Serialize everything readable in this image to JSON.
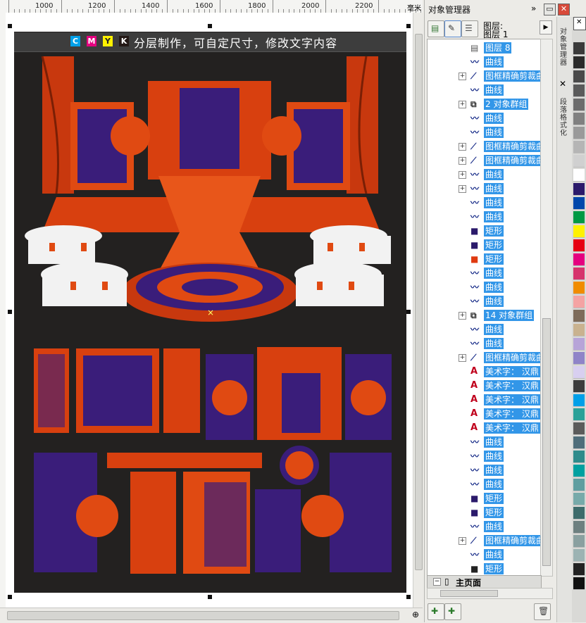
{
  "ruler": {
    "labels": [
      "1000",
      "1200",
      "1400",
      "1600",
      "1800",
      "2000",
      "2200"
    ],
    "unit": "毫米"
  },
  "canvas": {
    "banner_text": "分层制作，可自定尺寸，修改文字内容",
    "cmyk_letters": [
      "C",
      "M",
      "Y",
      "K"
    ],
    "cmyk_colors": [
      "#00a0e9",
      "#e4007f",
      "#fff100",
      "#231815"
    ],
    "artboard_color": "#232120"
  },
  "object_manager": {
    "title": "对象管理器",
    "layer_label": "图层:",
    "layer_value": "图层 1",
    "footer_label": "主页面",
    "rows": [
      {
        "label": "图层 8",
        "icon": "layer-icon",
        "expander": false,
        "selected": true
      },
      {
        "label": "曲线",
        "icon": "curve-icon",
        "expander": false,
        "selected": true
      },
      {
        "label": "图框精确剪裁曲",
        "icon": "powerclip-icon",
        "expander": true,
        "selected": true
      },
      {
        "label": "曲线",
        "icon": "curve-icon",
        "expander": false,
        "selected": true
      },
      {
        "label": "2 对象群组",
        "icon": "group-icon",
        "expander": true,
        "selected": true
      },
      {
        "label": "曲线",
        "icon": "curve-icon",
        "expander": false,
        "selected": true
      },
      {
        "label": "曲线",
        "icon": "curve-icon",
        "expander": false,
        "selected": true
      },
      {
        "label": "图框精确剪裁曲",
        "icon": "powerclip-icon",
        "expander": true,
        "selected": true
      },
      {
        "label": "图框精确剪裁曲",
        "icon": "powerclip-icon",
        "expander": true,
        "selected": true
      },
      {
        "label": "曲线",
        "icon": "curve-icon",
        "expander": true,
        "selected": true
      },
      {
        "label": "曲线",
        "icon": "curve-icon",
        "expander": true,
        "selected": true
      },
      {
        "label": "曲线",
        "icon": "curve-icon",
        "expander": false,
        "selected": true
      },
      {
        "label": "曲线",
        "icon": "curve-icon",
        "expander": false,
        "selected": true
      },
      {
        "label": "矩形",
        "icon": "rect-purple-icon",
        "expander": false,
        "selected": true
      },
      {
        "label": "矩形",
        "icon": "rect-purple-icon",
        "expander": false,
        "selected": true
      },
      {
        "label": "矩形",
        "icon": "rect-red-icon",
        "expander": false,
        "selected": true
      },
      {
        "label": "曲线",
        "icon": "curve-icon",
        "expander": false,
        "selected": true
      },
      {
        "label": "曲线",
        "icon": "curve-icon",
        "expander": false,
        "selected": true
      },
      {
        "label": "曲线",
        "icon": "curve-icon",
        "expander": false,
        "selected": true
      },
      {
        "label": "14 对象群组",
        "icon": "group-icon",
        "expander": true,
        "selected": true
      },
      {
        "label": "曲线",
        "icon": "curve-icon",
        "expander": false,
        "selected": true
      },
      {
        "label": "曲线",
        "icon": "curve-icon",
        "expander": false,
        "selected": true
      },
      {
        "label": "图框精确剪裁曲",
        "icon": "powerclip-icon",
        "expander": true,
        "selected": true
      },
      {
        "label": "美术字： 汉鼎",
        "icon": "artistic-text-icon",
        "expander": false,
        "selected": true
      },
      {
        "label": "美术字： 汉鼎",
        "icon": "artistic-text-icon",
        "expander": false,
        "selected": true
      },
      {
        "label": "美术字： 汉鼎",
        "icon": "artistic-text-icon",
        "expander": false,
        "selected": true
      },
      {
        "label": "美术字： 汉鼎",
        "icon": "artistic-text-icon",
        "expander": false,
        "selected": true
      },
      {
        "label": "美术字： 汉鼎",
        "icon": "artistic-text-icon",
        "expander": false,
        "selected": true
      },
      {
        "label": "曲线",
        "icon": "curve-icon",
        "expander": false,
        "selected": true
      },
      {
        "label": "曲线",
        "icon": "curve-icon",
        "expander": false,
        "selected": true
      },
      {
        "label": "曲线",
        "icon": "curve-icon",
        "expander": false,
        "selected": true
      },
      {
        "label": "曲线",
        "icon": "curve-icon",
        "expander": false,
        "selected": true
      },
      {
        "label": "矩形",
        "icon": "rect-purple-icon",
        "expander": false,
        "selected": true
      },
      {
        "label": "矩形",
        "icon": "rect-purple-icon",
        "expander": false,
        "selected": true
      },
      {
        "label": "曲线",
        "icon": "curve-icon",
        "expander": false,
        "selected": true
      },
      {
        "label": "图框精确剪裁曲",
        "icon": "powerclip-icon",
        "expander": true,
        "selected": true
      },
      {
        "label": "曲线",
        "icon": "curve-icon",
        "expander": false,
        "selected": true
      },
      {
        "label": "矩形",
        "icon": "rect-dark-icon",
        "expander": false,
        "selected": true
      }
    ]
  },
  "side_tabs": [
    "对象管理器",
    "段落格式化"
  ],
  "palette": [
    "#ffffff",
    "#3a3a3a",
    "#2a2a2a",
    "#4a4a4a",
    "#5a5a5a",
    "#6c6c6c",
    "#808080",
    "#9a9a9a",
    "#b5b5b5",
    "#d0d0d0",
    "#ffffff",
    "#2b1a6b",
    "#0047ab",
    "#009944",
    "#fff100",
    "#e60012",
    "#e4007f",
    "#d6336c",
    "#f08c00",
    "#f4a3a3",
    "#7d6b5a",
    "#c9b28f",
    "#b7a4d8",
    "#8f84c8",
    "#d8cff0",
    "#3c3c3c",
    "#009fe8",
    "#2aa198",
    "#5b5b5b",
    "#4f6d7a",
    "#2e8b8b",
    "#00a0a0",
    "#5f9ea0",
    "#7aa",
    "#3d6b6b",
    "#6d8080",
    "#8aa0a0",
    "#9cb3b3",
    "#222222",
    "#111111"
  ]
}
